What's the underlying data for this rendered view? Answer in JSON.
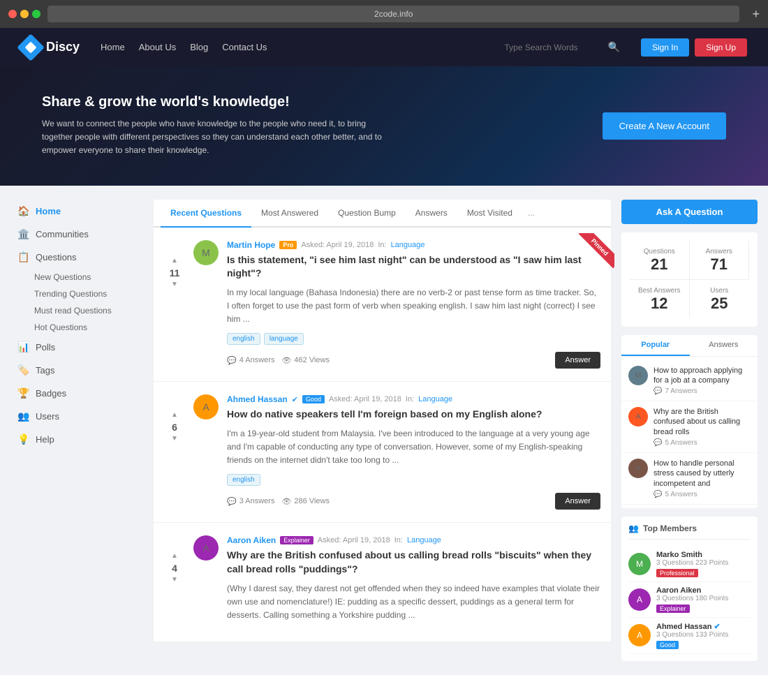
{
  "browser": {
    "url": "2code.info",
    "plus": "+"
  },
  "navbar": {
    "logo_text": "Discy",
    "links": [
      {
        "label": "Home",
        "href": "#"
      },
      {
        "label": "About Us",
        "href": "#"
      },
      {
        "label": "Blog",
        "href": "#"
      },
      {
        "label": "Contact Us",
        "href": "#"
      }
    ],
    "search_placeholder": "Type Search Words",
    "signin_label": "Sign In",
    "signup_label": "Sign Up"
  },
  "hero": {
    "title": "Share & grow the world's knowledge!",
    "text": "We want to connect the people who have knowledge to the people who need it, to bring together people with different perspectives so they can understand each other better, and to empower everyone to share their knowledge.",
    "cta_label": "Create A New Account"
  },
  "sidebar": {
    "items": [
      {
        "label": "Home",
        "icon": "🏠",
        "active": true
      },
      {
        "label": "Communities",
        "icon": "🏛️"
      },
      {
        "label": "Questions",
        "icon": "📋",
        "sub": [
          "New Questions",
          "Trending Questions",
          "Must read Questions",
          "Hot Questions"
        ]
      },
      {
        "label": "Polls",
        "icon": "📊"
      },
      {
        "label": "Tags",
        "icon": "🏷️"
      },
      {
        "label": "Badges",
        "icon": "🏆"
      },
      {
        "label": "Users",
        "icon": "👥"
      },
      {
        "label": "Help",
        "icon": "💡"
      }
    ]
  },
  "tabs": {
    "items": [
      "Recent Questions",
      "Most Answered",
      "Question Bump",
      "Answers",
      "Most Visited",
      "..."
    ],
    "active": 0
  },
  "questions": [
    {
      "id": 1,
      "author": "Martin Hope",
      "badge": "pro",
      "badge_label": "Pro",
      "asked": "Asked: April 19, 2018",
      "in_label": "In:",
      "category": "Language",
      "title": "Is this statement, \"i see him last night\" can be understood as \"I saw him last night\"?",
      "excerpt": "In my local language (Bahasa Indonesia) there are no verb-2 or past tense form as time tracker. So, I often forget to use the past form of verb when speaking english. I saw him last night (correct) I see him ...",
      "tags": [
        "english",
        "language"
      ],
      "votes": 11,
      "answers": 4,
      "views": 462,
      "answers_label": "4 Answers",
      "views_label": "462 Views",
      "answer_btn": "Answer",
      "pinned": true
    },
    {
      "id": 2,
      "author": "Ahmed Hassan",
      "verified": true,
      "badge": "good",
      "badge_label": "Good",
      "asked": "Asked: April 19, 2018",
      "in_label": "In:",
      "category": "Language",
      "title": "How do native speakers tell I'm foreign based on my English alone?",
      "excerpt": "I'm a 19-year-old student from Malaysia. I've been introduced to the language at a very young age and I'm capable of conducting any type of conversation. However, some of my English-speaking friends on the internet didn't take too long to ...",
      "tags": [
        "english"
      ],
      "votes": 6,
      "answers": 3,
      "views": 286,
      "answers_label": "3 Answers",
      "views_label": "286 Views",
      "answer_btn": "Answer",
      "pinned": false
    },
    {
      "id": 3,
      "author": "Aaron Aiken",
      "badge": "explainer",
      "badge_label": "Explainer",
      "asked": "Asked: April 19, 2018",
      "in_label": "In:",
      "category": "Language",
      "title": "Why are the British confused about us calling bread rolls \"biscuits\" when they call bread rolls \"puddings\"?",
      "excerpt": "(Why I darest say, they darest not get offended when they so indeed have examples that violate their own use and nomenclature!) IE: pudding as a specific dessert, puddings as a general term for desserts. Calling something a Yorkshire pudding ...",
      "tags": [],
      "votes": 4,
      "pinned": false
    }
  ],
  "right_sidebar": {
    "ask_btn": "Ask A Question",
    "stats": {
      "questions_label": "Questions",
      "questions_value": "21",
      "answers_label": "Answers",
      "answers_value": "71",
      "best_answers_label": "Best Answers",
      "best_answers_value": "12",
      "users_label": "Users",
      "users_value": "25"
    },
    "popular_tabs": [
      "Popular",
      "Answers"
    ],
    "popular_items": [
      {
        "title": "How to approach applying for a job at a company",
        "answers": "7 Answers"
      },
      {
        "title": "Why are the British confused about us calling bread rolls",
        "answers": "5 Answers"
      },
      {
        "title": "How to handle personal stress caused by utterly incompetent and",
        "answers": "5 Answers"
      }
    ],
    "top_members_label": "Top Members",
    "members": [
      {
        "name": "Marko Smith",
        "stats": "3 Questions  223 Points",
        "badge": "Professional",
        "badge_type": "professional"
      },
      {
        "name": "Aaron Aiken",
        "stats": "3 Questions  180 Points",
        "badge": "Explainer",
        "badge_type": "explainer"
      },
      {
        "name": "Ahmed Hassan",
        "verified": true,
        "stats": "3 Questions  133 Points",
        "badge": "Good",
        "badge_type": "good"
      }
    ]
  }
}
